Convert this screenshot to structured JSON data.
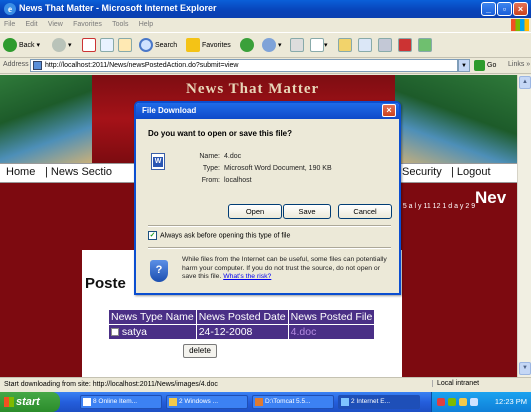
{
  "window": {
    "title": "News That Matter - Microsoft Internet Explorer",
    "minimize": "_",
    "maximize": "▫",
    "close": "×"
  },
  "menu": [
    "File",
    "Edit",
    "View",
    "Favorites",
    "Tools",
    "Help"
  ],
  "toolbar": {
    "back_label": "Back",
    "search_label": "Search",
    "favorites_label": "Favorites"
  },
  "address": {
    "label": "Address",
    "url": "http://localhost:2011/News/newsPostedAction.do?submit=view",
    "go_label": "Go",
    "links_label": "Links"
  },
  "site": {
    "title": "News That Matter",
    "nav": {
      "home": "Home",
      "news_section": "| News Sectio",
      "security": "Security",
      "logout": "| Logout"
    },
    "new_title": "Nev",
    "posted_heading": "Poste",
    "table": {
      "headers": [
        "News Type Name",
        "News Posted Date",
        "News Posted File"
      ],
      "rows": [
        {
          "type": "satya",
          "date": "24-12-2008",
          "file": "4.doc"
        }
      ]
    },
    "delete_label": "delete",
    "clock_text": "e 5 a l y   11 12 1 d   a y   2 9"
  },
  "dialog": {
    "title": "File Download",
    "question": "Do you want to open or save this file?",
    "name_label": "Name:",
    "name_value": "4.doc",
    "type_label": "Type:",
    "type_value": "Microsoft Word Document, 190 KB",
    "from_label": "From:",
    "from_value": "localhost",
    "open_label": "Open",
    "save_label": "Save",
    "cancel_label": "Cancel",
    "always_ask_label": "Always ask before opening this type of file",
    "always_ask_checked": true,
    "warning_text": "While files from the Internet can be useful, some files can potentially harm your computer. If you do not trust the source, do not open or save this file.",
    "risk_link": "What's the risk?",
    "close_glyph": "×"
  },
  "status": {
    "text": "Start downloading from site: http://localhost:2011/News/images/4.doc",
    "zone": "Local intranet"
  },
  "taskbar": {
    "start_label": "start",
    "tasks": [
      "8 Online Item...",
      "2 Windows ...",
      "D:\\Tomcat 5.5...",
      "2 Internet E..."
    ],
    "time": "12:23 PM"
  },
  "colors": {
    "xp_blue": "#0a5fd8",
    "banner_red": "#7d0a10",
    "table_purple": "#4a2f86",
    "start_green": "#2b8c2b"
  }
}
